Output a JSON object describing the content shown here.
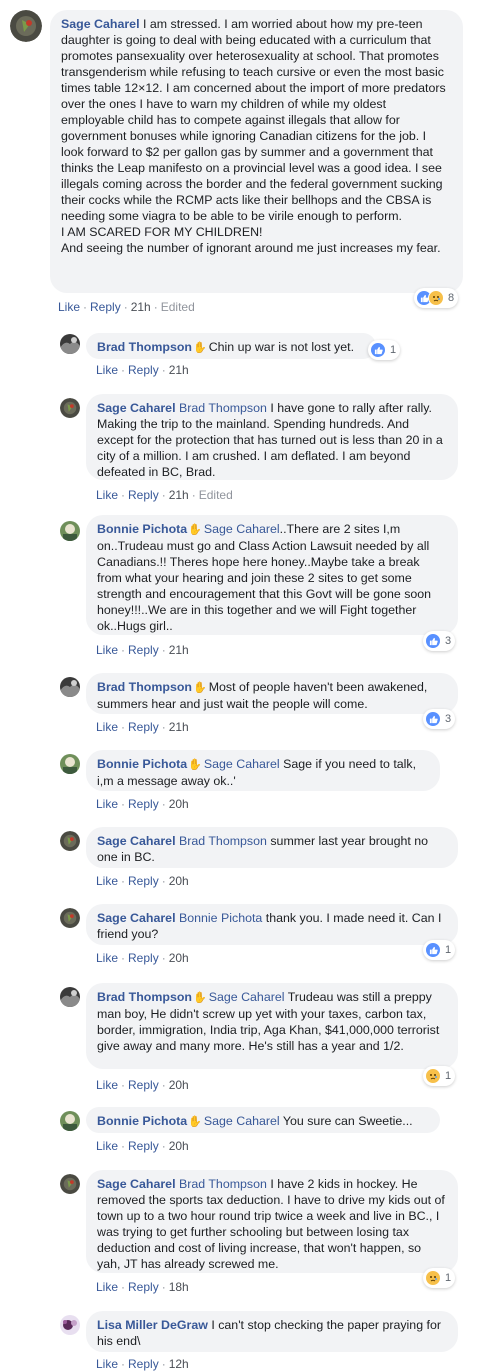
{
  "actions": {
    "like": "Like",
    "reply": "Reply",
    "sep": "·",
    "edited": "Edited"
  },
  "colors": {
    "link": "#385898",
    "bubble": "#f2f3f5",
    "like_blue": "#5890ff",
    "sad_yellow": "#f7c04a"
  },
  "comments": [
    {
      "author": "Sage Caharel",
      "text": "I am stressed. I am worried about how my pre-teen daughter is going to deal with being educated with a curriculum that promotes pansexuality over heterosexuality at school. That promotes transgenderism while refusing to teach cursive or even the most basic times table 12×12. I am concerned about the import of more predators over the ones I have to warn my children of while my oldest employable child has to compete against illegals that allow for government bonuses while ignoring Canadian citizens for the job. I look forward to $2 per gallon gas by summer and a government that thinks the Leap manifesto on a provincial level was a good idea. I see illegals coming across the border and the federal government sucking their cocks while the RCMP acts like their bellhops and the CBSA is needing some viagra to be able to be virile enough to perform.",
      "text2": "I AM SCARED FOR MY CHILDREN!",
      "text3": "And seeing the number of ignorant around me just increases my fear.",
      "time": "21h",
      "reactions": {
        "icons": [
          "like-icon",
          "sad-icon"
        ],
        "count": "8"
      }
    },
    {
      "author": "Brad Thompson",
      "text": "Chin up war is not lost yet.",
      "time": "21h",
      "reactions": {
        "icons": [
          "like-icon"
        ],
        "count": "1"
      }
    },
    {
      "author": "Sage Caharel",
      "tag": "Brad Thompson",
      "text": "I have gone to rally after rally. Making the trip to the mainland. Spending hundreds. And except for the protection that has turned out is less than 20 in a city of a million. I am crushed. I am deflated. I am beyond defeated in BC, Brad.",
      "time": "21h"
    },
    {
      "author": "Bonnie Pichota",
      "tag": "Sage Caharel",
      "text": "..There are 2 sites I,m on..Trudeau must go and Class Action Lawsuit needed by all Canadians.!! Theres hope here honey..Maybe take a break from what your hearing and join these 2 sites to get some strength and encouragement that this Govt will be gone soon honey!!!..We are in this together and we will Fight together ok..Hugs girl..",
      "time": "21h",
      "reactions": {
        "icons": [
          "like-icon"
        ],
        "count": "3"
      }
    },
    {
      "author": "Brad Thompson",
      "text": "Most of people haven't been awakened, summers hear and just wait the people will come.",
      "time": "21h",
      "reactions": {
        "icons": [
          "like-icon"
        ],
        "count": "3"
      }
    },
    {
      "author": "Bonnie Pichota",
      "tag": "Sage Caharel",
      "text": "Sage if you need to talk, i,m a message away ok..'",
      "time": "20h"
    },
    {
      "author": "Sage Caharel",
      "tag": "Brad Thompson",
      "text": "summer last year brought no one in BC.",
      "time": "20h"
    },
    {
      "author": "Sage Caharel",
      "tag": "Bonnie Pichota",
      "text": "thank you. I made need it. Can I friend you?",
      "time": "20h",
      "reactions": {
        "icons": [
          "like-icon"
        ],
        "count": "1"
      }
    },
    {
      "author": "Brad Thompson",
      "tag": "Sage Caharel",
      "text": "Trudeau was still a preppy man boy, He didn't screw up yet with your taxes, carbon tax, border, immigration, India trip, Aga Khan, $41,000,000 terrorist give away and many more. He's still has a year and 1/2.",
      "time": "20h",
      "reactions": {
        "icons": [
          "sad-icon"
        ],
        "count": "1"
      }
    },
    {
      "author": "Bonnie Pichota",
      "tag": "Sage Caharel",
      "text": "You sure can Sweetie...",
      "time": "20h"
    },
    {
      "author": "Sage Caharel",
      "tag": "Brad Thompson",
      "text": "I have 2 kids in hockey. He removed the sports tax deduction. I have to drive my kids out of town up to a two hour round trip twice a week and live in BC., I was trying to get further schooling but between losing tax deduction and cost of living increase, that won't happen, so yah, JT has already screwed me.",
      "time": "18h",
      "reactions": {
        "icons": [
          "sad-icon"
        ],
        "count": "1"
      }
    },
    {
      "author": "Lisa Miller DeGraw",
      "text": "I can't stop checking the paper praying for his end\\",
      "time": "12h"
    }
  ]
}
